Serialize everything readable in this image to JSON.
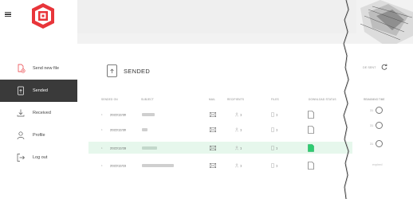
{
  "sidebar": {
    "menu_icon": "hamburger-icon",
    "logo_icon": "logo-icon",
    "items": [
      {
        "label": "Send new file",
        "icon": "send-file-icon",
        "active": false
      },
      {
        "label": "Sended",
        "icon": "sended-icon",
        "active": true
      },
      {
        "label": "Received",
        "icon": "download-icon",
        "active": false
      },
      {
        "label": "Profile",
        "icon": "profile-icon",
        "active": false
      },
      {
        "label": "Log out",
        "icon": "logout-icon",
        "active": false
      }
    ]
  },
  "main": {
    "title": "SENDED",
    "sort_label": "DE SENT",
    "columns": [
      "SENDED ON",
      "SUBJECT",
      "MAIL",
      "RECIPIENTS",
      "FILES",
      "DOWNLOAD STATUS",
      "REMAINING TIME"
    ],
    "rows": [
      {
        "date": "2022/12/30",
        "recipients": "1",
        "files": "1",
        "remaining": "31",
        "expired": false,
        "highlight": false
      },
      {
        "date": "2022/12/30",
        "recipients": "1",
        "files": "1",
        "remaining": "31",
        "expired": false,
        "highlight": false
      },
      {
        "date": "2022/12/28",
        "recipients": "1",
        "files": "1",
        "remaining": "31",
        "expired": false,
        "highlight": true
      },
      {
        "date": "2022/12/16",
        "recipients": "1",
        "files": "1",
        "remaining": "",
        "expired": true,
        "expired_label": "expired",
        "highlight": false
      }
    ]
  },
  "colors": {
    "active_bg": "#3a3a3a",
    "highlight_row": "#e6f7ec",
    "download_done": "#2ecc71",
    "logo_red": "#e8353a"
  }
}
